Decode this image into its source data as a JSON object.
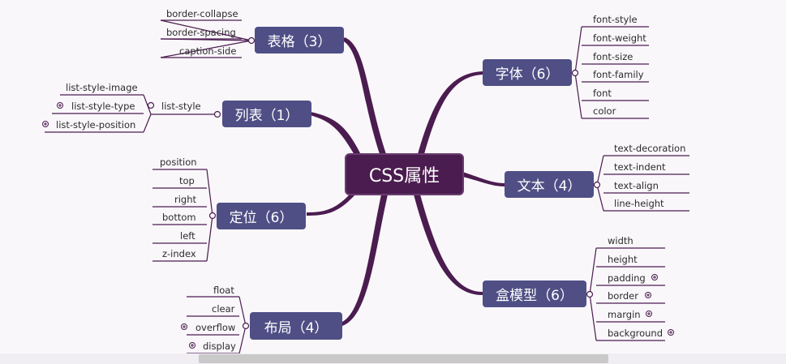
{
  "center": {
    "label": "CSS属性"
  },
  "branches": {
    "table": {
      "label": "表格（3）",
      "items": [
        "border-collapse",
        "border-spacing",
        "caption-side"
      ]
    },
    "list": {
      "label": "列表（1）",
      "item": "list-style",
      "subitems": [
        "list-style-image",
        "list-style-type",
        "list-style-position"
      ]
    },
    "position": {
      "label": "定位（6）",
      "items": [
        "position",
        "top",
        "right",
        "bottom",
        "left",
        "z-index"
      ]
    },
    "layout": {
      "label": "布局（4）",
      "items": [
        "float",
        "clear",
        "overflow",
        "display"
      ]
    },
    "font": {
      "label": "字体（6）",
      "items": [
        "font-style",
        "font-weight",
        "font-size",
        "font-family",
        "font",
        "color"
      ]
    },
    "text": {
      "label": "文本（4）",
      "items": [
        "text-decoration",
        "text-indent",
        "text-align",
        "line-height"
      ]
    },
    "box": {
      "label": "盒模型（6）",
      "items": [
        "width",
        "height",
        "padding",
        "border",
        "margin",
        "background"
      ]
    }
  },
  "colors": {
    "trunk": "#4b1c4f",
    "node": "#4f4f86",
    "leaf_line": "#4b1c4f",
    "background": "#faf7fb"
  }
}
